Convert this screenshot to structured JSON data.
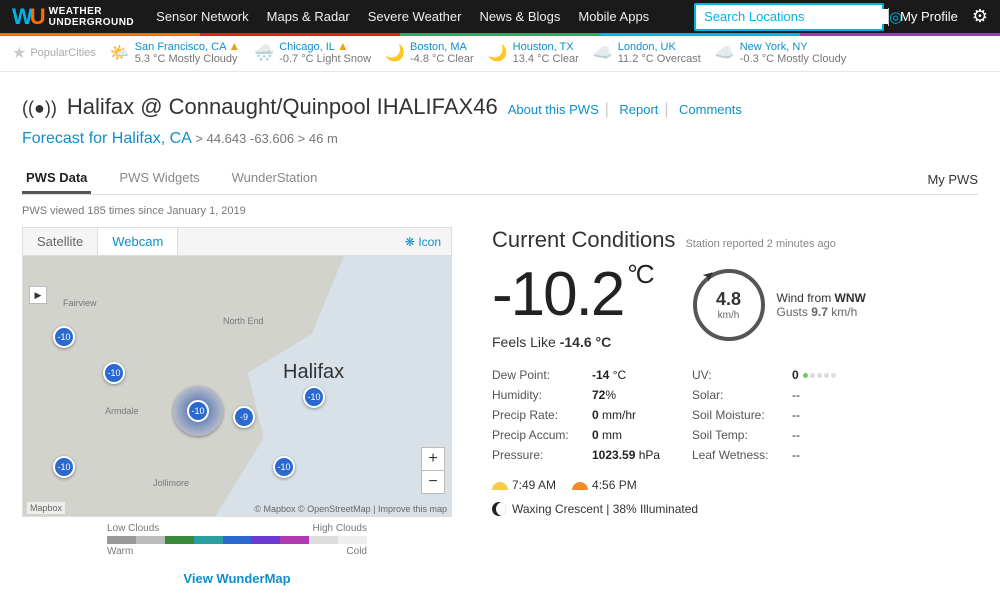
{
  "brand": {
    "mark_w": "W",
    "mark_u": "U",
    "name_line1": "WEATHER",
    "name_line2": "UNDERGROUND"
  },
  "nav": {
    "items": [
      "Sensor Network",
      "Maps & Radar",
      "Severe Weather",
      "News & Blogs",
      "Mobile Apps"
    ],
    "search_placeholder": "Search Locations",
    "profile": "My Profile"
  },
  "popular": {
    "label_1": "Popular",
    "label_2": "Cities",
    "cities": [
      {
        "name": "San Francisco, CA",
        "temp": "5.3 °C",
        "cond": "Mostly Cloudy",
        "ico": "🌤️",
        "warn": true
      },
      {
        "name": "Chicago, IL",
        "temp": "-0.7 °C",
        "cond": "Light Snow",
        "ico": "🌨️",
        "warn": true
      },
      {
        "name": "Boston, MA",
        "temp": "-4.8 °C",
        "cond": "Clear",
        "ico": "🌙",
        "warn": false
      },
      {
        "name": "Houston, TX",
        "temp": "13.4 °C",
        "cond": "Clear",
        "ico": "🌙",
        "warn": false
      },
      {
        "name": "London, UK",
        "temp": "11.2 °C",
        "cond": "Overcast",
        "ico": "☁️",
        "warn": false
      },
      {
        "name": "New York, NY",
        "temp": "-0.3 °C",
        "cond": "Mostly Cloudy",
        "ico": "☁️",
        "warn": false
      }
    ]
  },
  "station": {
    "signal": "((●))",
    "title": "Halifax @ Connaught/Quinpool",
    "code": "IHALIFAX46",
    "about": "About this PWS",
    "report": "Report",
    "comments": "Comments"
  },
  "forecast": {
    "label": "Forecast for Halifax, CA",
    "coords": "> 44.643 -63.606 > 46 m"
  },
  "tabs": {
    "items": [
      "PWS Data",
      "PWS Widgets",
      "WunderStation"
    ],
    "active": 0,
    "mypws": "My PWS"
  },
  "viewed": "PWS viewed 185 times since January 1, 2019",
  "map": {
    "tabs": [
      "Satellite",
      "Webcam"
    ],
    "active": 1,
    "icon_link": "Icon",
    "city_label": "Halifax",
    "labels": [
      "Fairview",
      "North End",
      "Armdale",
      "Jollimore"
    ],
    "markers": [
      "-10",
      "-10",
      "-10",
      "-9",
      "-10",
      "-10",
      "-10"
    ],
    "attrib": "© Mapbox © OpenStreetMap | Improve this map",
    "mapbox": "Mapbox",
    "legend_low": "Low Clouds",
    "legend_high": "High Clouds",
    "legend_warm": "Warm",
    "legend_cold": "Cold",
    "wundermap": "View WunderMap"
  },
  "cc": {
    "title": "Current Conditions",
    "reported": "Station reported 2 minutes ago",
    "temp": "-10.2",
    "temp_unit": "°C",
    "feels_label": "Feels Like",
    "feels": "-14.6 °C",
    "wind": {
      "speed": "4.8",
      "unit": "km/h",
      "from_label": "Wind from",
      "dir": "WNW",
      "gust_label": "Gusts",
      "gust": "9.7",
      "gust_unit": "km/h"
    },
    "rows": [
      {
        "l": "Dew Point:",
        "v": "-14",
        "u": "°C"
      },
      {
        "l": "Humidity:",
        "v": "72",
        "u": "%"
      },
      {
        "l": "Precip Rate:",
        "v": "0",
        "u": "mm/hr"
      },
      {
        "l": "Precip Accum:",
        "v": "0",
        "u": "mm"
      },
      {
        "l": "Pressure:",
        "v": "1023.59",
        "u": "hPa"
      }
    ],
    "rows2": [
      {
        "l": "UV:",
        "v": "0"
      },
      {
        "l": "Solar:",
        "v": "--"
      },
      {
        "l": "Soil Moisture:",
        "v": "--"
      },
      {
        "l": "Soil Temp:",
        "v": "--"
      },
      {
        "l": "Leaf Wetness:",
        "v": "--"
      }
    ],
    "sunrise": "7:49 AM",
    "sunset": "4:56 PM",
    "moon": "Waxing Crescent | 38% Illuminated"
  }
}
